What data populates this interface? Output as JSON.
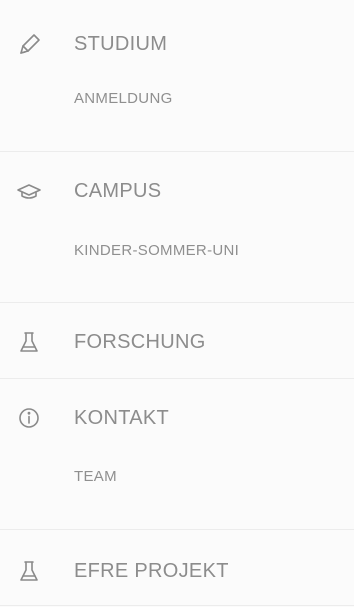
{
  "nav": {
    "items": [
      {
        "label": "STUDIUM",
        "icon": "pencil-icon",
        "sub": [
          "ANMELDUNG"
        ]
      },
      {
        "label": "CAMPUS",
        "icon": "graduation-cap-icon",
        "sub": [
          "KINDER-SOMMER-UNI"
        ]
      },
      {
        "label": "FORSCHUNG",
        "icon": "flask-icon",
        "sub": []
      },
      {
        "label": "KONTAKT",
        "icon": "info-icon",
        "sub": [
          "TEAM"
        ]
      },
      {
        "label": "EFRE PROJEKT",
        "icon": "flask-icon",
        "sub": []
      }
    ]
  },
  "colors": {
    "background": "#fbfbfb",
    "text": "#8c8c8c",
    "icon": "#8a8a8a",
    "divider": "#ececec"
  }
}
